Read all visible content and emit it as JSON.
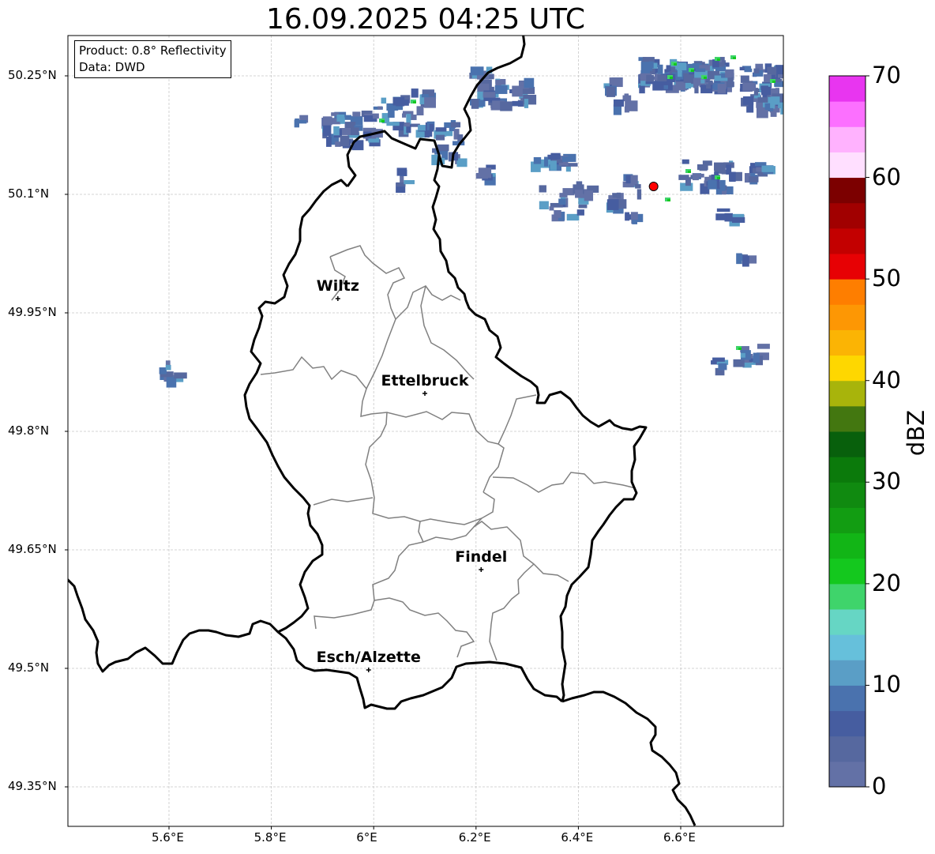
{
  "title": "16.09.2025 04:25 UTC",
  "info": {
    "product": "Product: 0.8° Reflectivity",
    "data": "Data: DWD"
  },
  "axes": {
    "lon_ticks": [
      "5.6°E",
      "5.8°E",
      "6°E",
      "6.2°E",
      "6.4°E",
      "6.6°E"
    ],
    "lat_ticks": [
      "50.25°N",
      "50.1°N",
      "49.95°N",
      "49.8°N",
      "49.65°N",
      "49.5°N",
      "49.35°N"
    ]
  },
  "cities": [
    {
      "name": "Wiltz",
      "lon": 5.93,
      "lat": 49.968
    },
    {
      "name": "Ettelbruck",
      "lon": 6.1,
      "lat": 49.848
    },
    {
      "name": "Findel",
      "lon": 6.21,
      "lat": 49.625
    },
    {
      "name": "Esch/Alzette",
      "lon": 5.99,
      "lat": 49.498
    }
  ],
  "radar_site": {
    "lon": 6.547,
    "lat": 50.11,
    "color": "#ff0000"
  },
  "colorbar": {
    "label": "dBZ",
    "min": 0,
    "max": 70,
    "step": 2.5,
    "ticks": [
      "0",
      "10",
      "20",
      "30",
      "40",
      "50",
      "60",
      "70"
    ],
    "colors": [
      "#6371a6",
      "#56689f",
      "#465da0",
      "#4a72ae",
      "#5a9ec6",
      "#66c0db",
      "#66d6c4",
      "#3fd46b",
      "#14c81e",
      "#12b516",
      "#129d12",
      "#108a10",
      "#0b7a0b",
      "#08600c",
      "#437710",
      "#a8b40b",
      "#fed700",
      "#fbb404",
      "#fd9704",
      "#fe7e00",
      "#e70104",
      "#c30000",
      "#a10000",
      "#7c0000",
      "#ffdfff",
      "#ffb2fe",
      "#fc70ff",
      "#e835f0"
    ]
  }
}
